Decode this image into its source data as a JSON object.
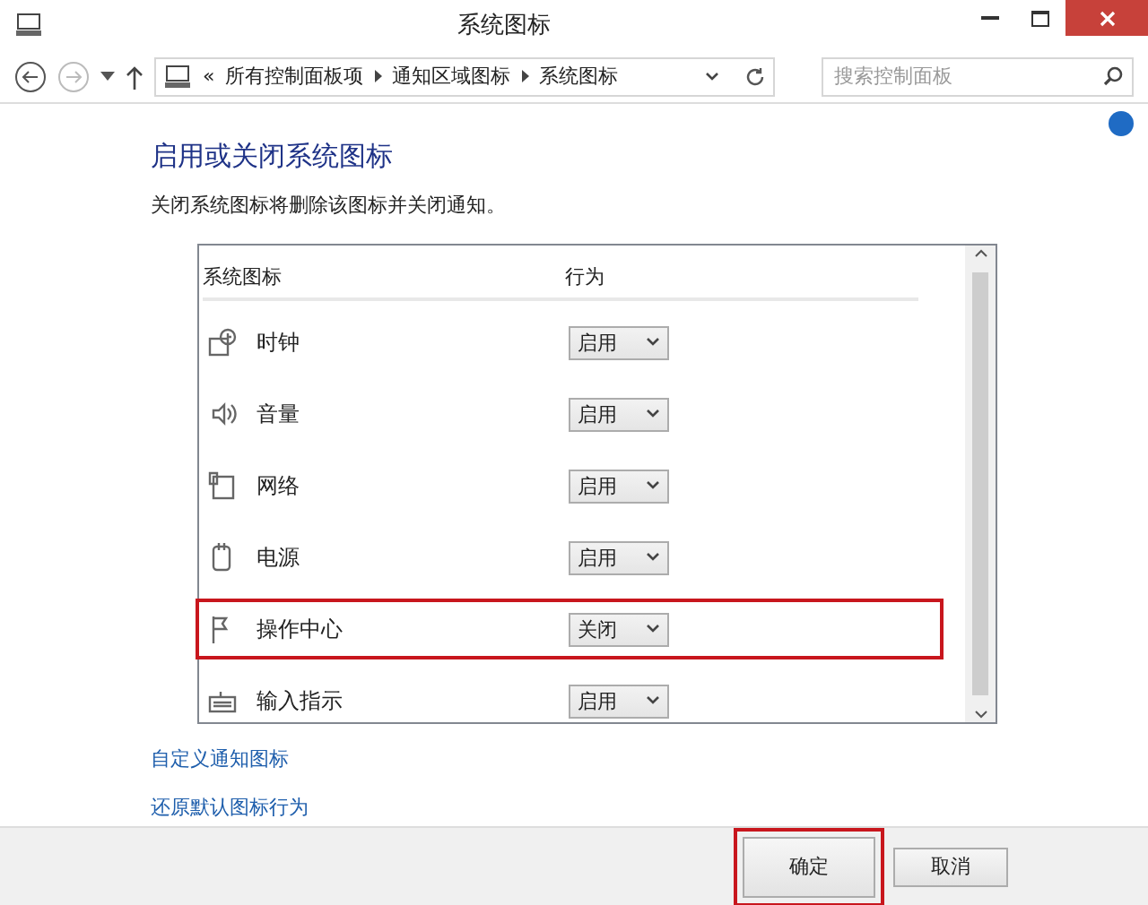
{
  "window": {
    "title": "系统图标"
  },
  "address_bar": {
    "overflow": "«",
    "crumbs": [
      "所有控制面板项",
      "通知区域图标",
      "系统图标"
    ]
  },
  "search": {
    "placeholder": "搜索控制面板"
  },
  "heading": "启用或关闭系统图标",
  "description": "关闭系统图标将删除该图标并关闭通知。",
  "table": {
    "columns": [
      "系统图标",
      "行为"
    ],
    "rows": [
      {
        "kind": "clock",
        "name": "时钟",
        "behavior": "启用",
        "highlighted": false
      },
      {
        "kind": "volume",
        "name": "音量",
        "behavior": "启用",
        "highlighted": false
      },
      {
        "kind": "network",
        "name": "网络",
        "behavior": "启用",
        "highlighted": false
      },
      {
        "kind": "power",
        "name": "电源",
        "behavior": "启用",
        "highlighted": false
      },
      {
        "kind": "flag",
        "name": "操作中心",
        "behavior": "关闭",
        "highlighted": true
      },
      {
        "kind": "keyboard",
        "name": "输入指示",
        "behavior": "启用",
        "highlighted": false
      }
    ]
  },
  "links": [
    "自定义通知图标",
    "还原默认图标行为"
  ],
  "buttons": [
    {
      "label": "确定",
      "highlighted": true
    },
    {
      "label": "取消",
      "highlighted": false
    }
  ]
}
